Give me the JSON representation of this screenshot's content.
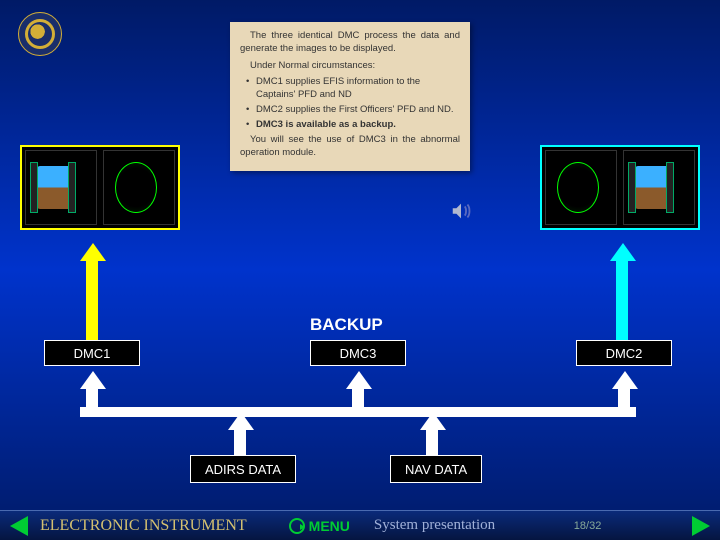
{
  "info": {
    "p1": "The three identical DMC process the data and generate the images to be displayed.",
    "p2": "Under Normal circumstances:",
    "li1": "DMC1 supplies EFIS information to the Captains' PFD and ND",
    "li2": "DMC2 supplies the First Officers' PFD and ND.",
    "li3": "DMC3 is available as a backup.",
    "p3": "You will see the use of DMC3 in the abnormal operation module."
  },
  "labels": {
    "backup": "BACKUP",
    "dmc1": "DMC1",
    "dmc2": "DMC2",
    "dmc3": "DMC3",
    "adirs": "ADIRS DATA",
    "nav": "NAV DATA"
  },
  "footer": {
    "title": "ELECTRONIC INSTRUMENT",
    "menu": "MENU",
    "subtitle": "System presentation",
    "page": "18/32"
  }
}
